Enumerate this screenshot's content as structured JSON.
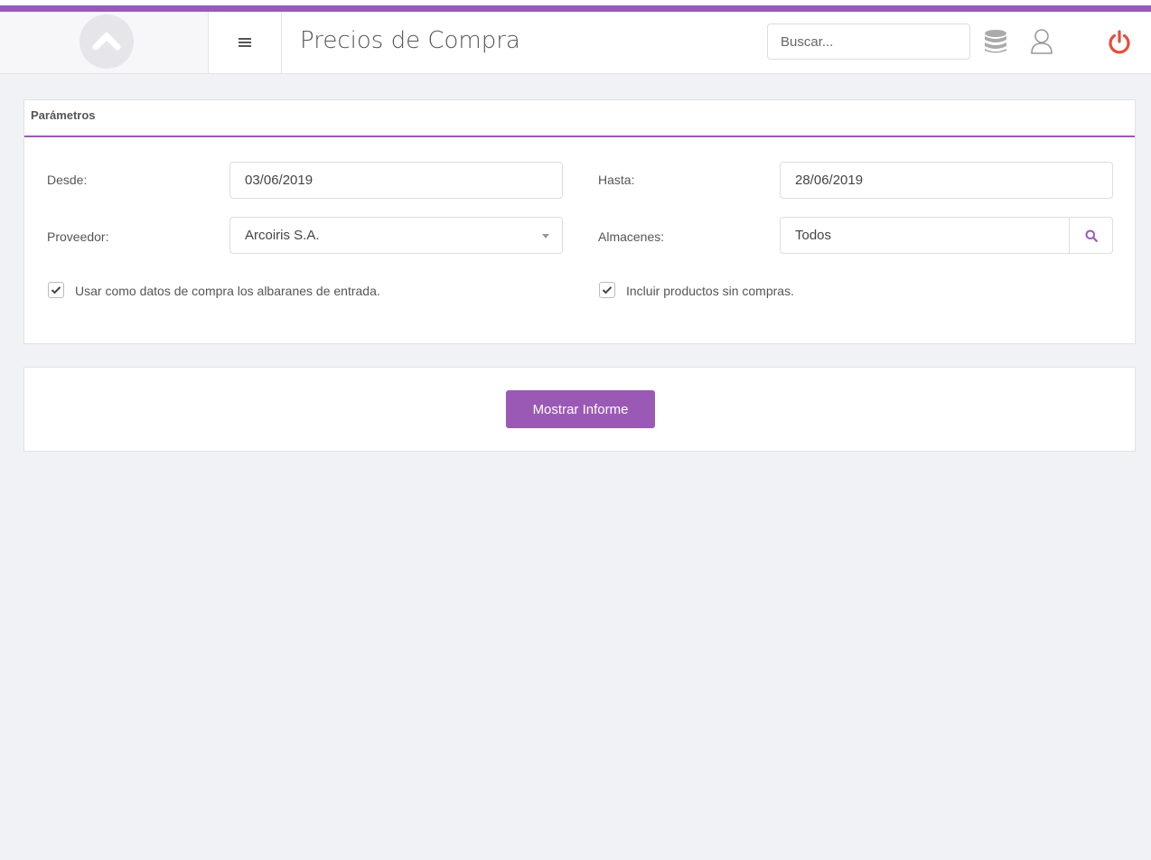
{
  "colors": {
    "accent": "#9b59b6",
    "power": "#e74c3c",
    "background": "#f1f2f6",
    "panel": "#ffffff"
  },
  "header": {
    "title": "Precios de Compra",
    "search_placeholder": "Buscar...",
    "icons": [
      "menu-icon",
      "database-icon",
      "user-icon",
      "power-icon"
    ]
  },
  "params": {
    "heading": "Parámetros",
    "desde_label": "Desde:",
    "desde_value": "03/06/2019",
    "hasta_label": "Hasta:",
    "hasta_value": "28/06/2019",
    "proveedor_label": "Proveedor:",
    "proveedor_value": "Arcoiris S.A.",
    "almacenes_label": "Almacenes:",
    "almacenes_value": "Todos",
    "check_albaranes_label": "Usar como datos de compra los albaranes de entrada.",
    "check_albaranes_checked": true,
    "check_sin_compras_label": "Incluir productos sin compras.",
    "check_sin_compras_checked": true
  },
  "actions": {
    "show_report_label": "Mostrar Informe"
  }
}
